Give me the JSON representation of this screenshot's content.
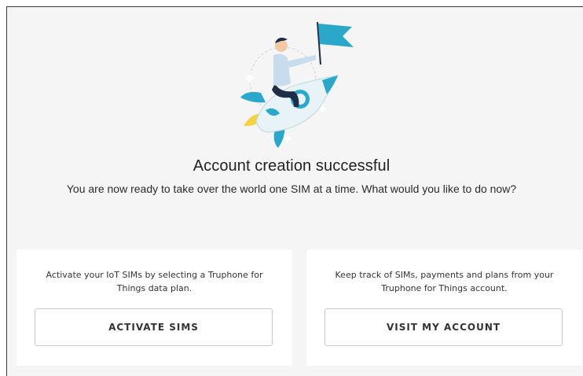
{
  "page": {
    "title": "Account creation successful",
    "subtitle": "You are now ready to take over the world one SIM at a time. What would you like to do now?"
  },
  "illustration": {
    "icon": "rocket-with-person-and-flag-illustration"
  },
  "cards": [
    {
      "description": "Activate your IoT SIMs by selecting a Truphone for Things data plan.",
      "button_label": "ACTIVATE SIMS"
    },
    {
      "description": "Keep track of SIMs, payments and plans from your Truphone for Things account.",
      "button_label": "VISIT MY ACCOUNT"
    }
  ],
  "colors": {
    "background": "#f5f5f5",
    "card": "#ffffff",
    "accent_teal": "#2aa7c9",
    "rocket_light": "#e8f3f7",
    "flame_yellow": "#f5d146",
    "shirt": "#c9dced",
    "pants": "#1e2d4a"
  }
}
